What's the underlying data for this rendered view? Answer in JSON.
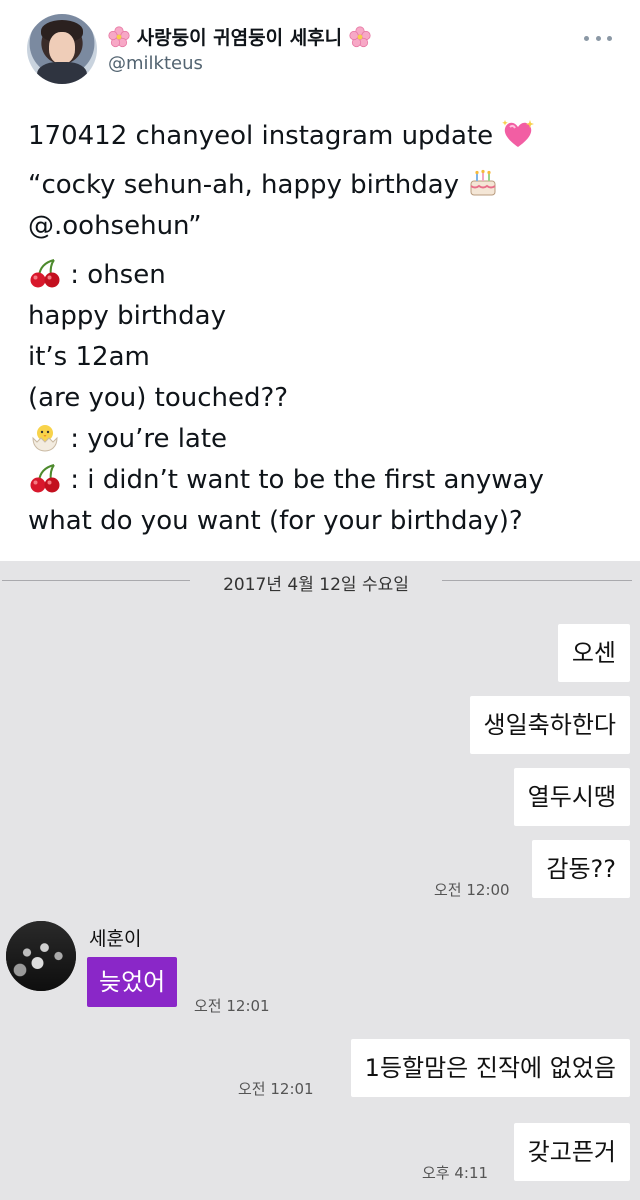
{
  "tweet": {
    "display_name": "사랑둥이 귀염둥이 세후니",
    "name_emoji": "cherry-blossom",
    "handle": "@milkteus",
    "lines": [
      {
        "emoji": "",
        "text": "170412 chanyeol instagram update",
        "emoji_after": "💖"
      },
      {
        "emoji": "",
        "text": "“cocky sehun-ah, happy birthday",
        "emoji_after": "🎂"
      },
      {
        "emoji": "",
        "text": "@.oohsehun”",
        "emoji_after": ""
      },
      {
        "emoji": "🍒",
        "text": ": ohsen",
        "emoji_after": ""
      },
      {
        "emoji": "",
        "text": "happy birthday",
        "emoji_after": ""
      },
      {
        "emoji": "",
        "text": "it’s 12am",
        "emoji_after": ""
      },
      {
        "emoji": "",
        "text": "(are you) touched??",
        "emoji_after": ""
      },
      {
        "emoji": "🐣",
        "text": ": you’re late",
        "emoji_after": ""
      },
      {
        "emoji": "🍒",
        "text": ": i didn’t want to be the first anyway",
        "emoji_after": ""
      },
      {
        "emoji": "",
        "text": "what do you want (for your birthday)?",
        "emoji_after": ""
      }
    ]
  },
  "chat": {
    "date": "2017년 4월 12일 수요일",
    "friend_name": "세훈이",
    "messages": [
      {
        "side": "right",
        "text": "오센"
      },
      {
        "side": "right",
        "text": "생일축하한다"
      },
      {
        "side": "right",
        "text": "열두시땡"
      },
      {
        "side": "right",
        "text": "감동??",
        "time": "오전 12:00"
      },
      {
        "side": "left",
        "text": "늦었어",
        "time": "오전 12:01"
      },
      {
        "side": "right",
        "text": "1등할맘은 진작에 없었음",
        "time": "오전 12:01"
      },
      {
        "side": "right",
        "text": "갖고픈거",
        "time": "오후 4:11"
      }
    ]
  },
  "colors": {
    "chat_background": "#e4e4e6",
    "friend_bubble": "#8a27c8",
    "my_bubble": "#ffffff"
  }
}
